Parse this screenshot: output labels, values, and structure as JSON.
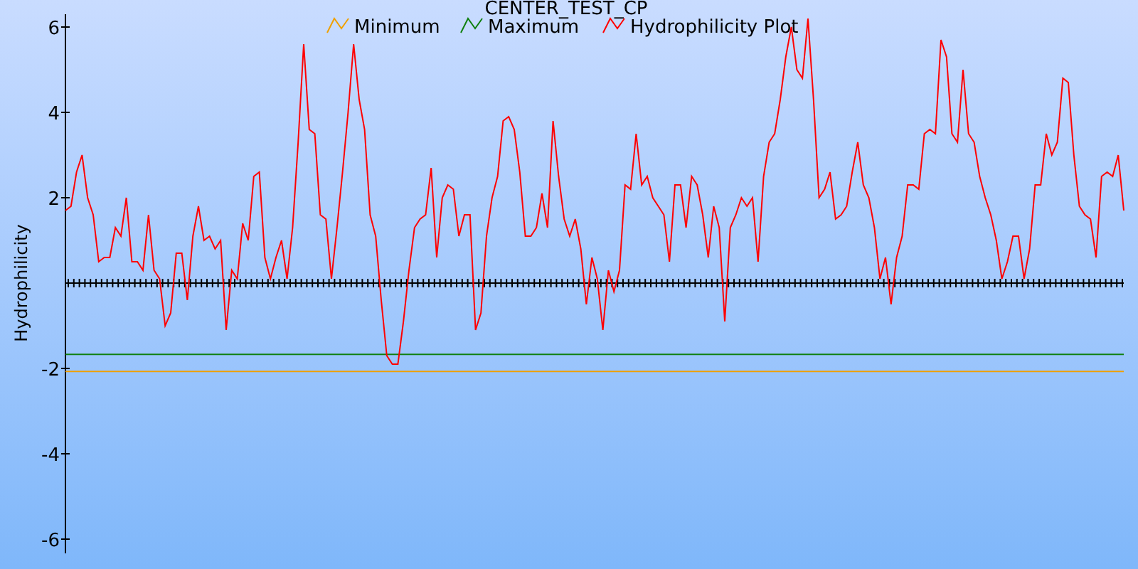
{
  "chart_data": {
    "type": "line",
    "title": "CENTER_TEST_CP",
    "ylabel": "Hydrophilicity",
    "ylim": [
      -6.3,
      6.3
    ],
    "legend": "top",
    "yticks": [
      6,
      4,
      2,
      -2,
      -4,
      -6
    ],
    "ref_lines": [
      {
        "axis": "y",
        "label": "Minimum",
        "color": "#f0a000",
        "value": -2.07
      },
      {
        "axis": "y",
        "label": "Maximum",
        "color": "#108010",
        "value": -1.67
      }
    ],
    "series": [
      {
        "name": "Hydrophilicity Plot",
        "color": "#ff0000",
        "values": [
          1.7,
          1.8,
          2.6,
          3.0,
          2.0,
          1.6,
          0.5,
          0.6,
          0.6,
          1.3,
          1.1,
          2.0,
          0.5,
          0.5,
          0.3,
          1.6,
          0.3,
          0.1,
          -1.0,
          -0.7,
          0.7,
          0.7,
          -0.4,
          1.1,
          1.8,
          1.0,
          1.1,
          0.8,
          1.0,
          -1.1,
          0.3,
          0.1,
          1.4,
          1.0,
          2.5,
          2.6,
          0.6,
          0.1,
          0.6,
          1.0,
          0.1,
          1.3,
          3.3,
          5.6,
          3.6,
          3.5,
          1.6,
          1.5,
          0.1,
          1.3,
          2.6,
          4.0,
          5.6,
          4.3,
          3.6,
          1.6,
          1.1,
          -0.4,
          -1.7,
          -1.9,
          -1.9,
          -0.9,
          0.3,
          1.3,
          1.5,
          1.6,
          2.7,
          0.6,
          2.0,
          2.3,
          2.2,
          1.1,
          1.6,
          1.6,
          -1.1,
          -0.7,
          1.1,
          2.0,
          2.5,
          3.8,
          3.9,
          3.6,
          2.6,
          1.1,
          1.1,
          1.3,
          2.1,
          1.3,
          3.8,
          2.5,
          1.5,
          1.1,
          1.5,
          0.8,
          -0.5,
          0.6,
          0.1,
          -1.1,
          0.3,
          -0.2,
          0.3,
          2.3,
          2.2,
          3.5,
          2.3,
          2.5,
          2.0,
          1.8,
          1.6,
          0.5,
          2.3,
          2.3,
          1.3,
          2.5,
          2.3,
          1.6,
          0.6,
          1.8,
          1.3,
          -0.9,
          1.3,
          1.6,
          2.0,
          1.8,
          2.0,
          0.5,
          2.5,
          3.3,
          3.5,
          4.3,
          5.3,
          6.0,
          5.0,
          4.8,
          6.2,
          4.3,
          2.0,
          2.2,
          2.6,
          1.5,
          1.6,
          1.8,
          2.6,
          3.3,
          2.3,
          2.0,
          1.3,
          0.1,
          0.6,
          -0.5,
          0.6,
          1.1,
          2.3,
          2.3,
          2.2,
          3.5,
          3.6,
          3.5,
          5.7,
          5.3,
          3.5,
          3.3,
          5.0,
          3.5,
          3.3,
          2.5,
          2.0,
          1.6,
          1.0,
          0.1,
          0.5,
          1.1,
          1.1,
          0.1,
          0.8,
          2.3,
          2.3,
          3.5,
          3.0,
          3.3,
          4.8,
          4.7,
          3.0,
          1.8,
          1.6,
          1.5,
          0.6,
          2.5,
          2.6,
          2.5,
          3.0,
          1.7
        ]
      }
    ]
  }
}
